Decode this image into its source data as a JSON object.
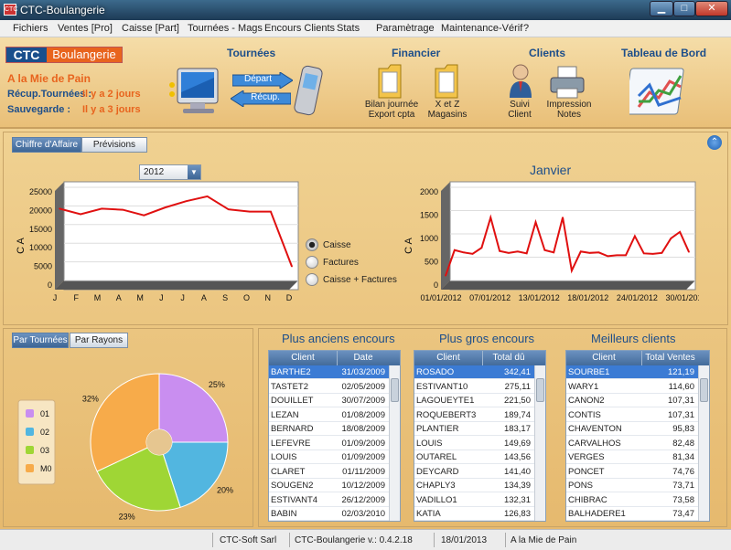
{
  "window": {
    "title": "CTC-Boulangerie",
    "icon_text": "CTC"
  },
  "menu": [
    "Fichiers",
    "Ventes [Pro]",
    "Caisse [Part]",
    "Tournées - Mags",
    "Encours Clients",
    "Stats",
    "Paramètrage",
    "Maintenance-Vérif",
    "?"
  ],
  "brand": {
    "ctc": "CTC",
    "boulangerie": "Boulangerie",
    "shop": "A la Mie de Pain",
    "recup_label": "Récup.Tournées :",
    "recup_value": "Il y a 2 jours",
    "save_label": "Sauvegarde :",
    "save_value": "Il y a 3 jours"
  },
  "sections": {
    "tournees": {
      "title": "Tournées",
      "depart": "Départ",
      "recup": "Récup."
    },
    "financier": {
      "title": "Financier",
      "bilan": "Bilan journée\nExport cpta",
      "xz": "X et Z\nMagasins"
    },
    "clients": {
      "title": "Clients",
      "suivi": "Suivi\nClient",
      "impression": "Impression\nNotes"
    },
    "tableau": {
      "title": "Tableau de Bord"
    }
  },
  "tabs_ca": [
    "Chiffre d'Affaire",
    "Prévisions"
  ],
  "year_select": "2012",
  "radios": {
    "caisse": "Caisse",
    "factures": "Factures",
    "both": "Caisse + Factures",
    "selected": "caisse"
  },
  "tabs_pie": [
    "Par Tournées",
    "Par Rayons"
  ],
  "grids": {
    "anciens": {
      "title": "Plus anciens encours",
      "col1": "Client",
      "col2": "Date",
      "rows": [
        [
          "BARTHE2",
          "31/03/2009"
        ],
        [
          "TASTET2",
          "02/05/2009"
        ],
        [
          "DOUILLET",
          "30/07/2009"
        ],
        [
          "LEZAN",
          "01/08/2009"
        ],
        [
          "BERNARD",
          "18/08/2009"
        ],
        [
          "LEFEVRE",
          "01/09/2009"
        ],
        [
          "LOUIS",
          "01/09/2009"
        ],
        [
          "CLARET",
          "01/11/2009"
        ],
        [
          "SOUGEN2",
          "10/12/2009"
        ],
        [
          "ESTIVANT4",
          "26/12/2009"
        ],
        [
          "BABIN",
          "02/03/2010"
        ]
      ]
    },
    "gros": {
      "title": "Plus gros encours",
      "col1": "Client",
      "col2": "Total dû",
      "rows": [
        [
          "ROSADO",
          "342,41"
        ],
        [
          "ESTIVANT10",
          "275,11"
        ],
        [
          "LAGOUEYTE1",
          "221,50"
        ],
        [
          "ROQUEBERT3",
          "189,74"
        ],
        [
          "PLANTIER",
          "183,17"
        ],
        [
          "LOUIS",
          "149,69"
        ],
        [
          "OUTAREL",
          "143,56"
        ],
        [
          "DEYCARD",
          "141,40"
        ],
        [
          "CHAPLY3",
          "134,39"
        ],
        [
          "VADILLO1",
          "132,31"
        ],
        [
          "KATIA",
          "126,83"
        ]
      ]
    },
    "meilleurs": {
      "title": "Meilleurs clients",
      "col1": "Client",
      "col2": "Total Ventes",
      "rows": [
        [
          "SOURBE1",
          "121,19"
        ],
        [
          "WARY1",
          "114,60"
        ],
        [
          "CANON2",
          "107,31"
        ],
        [
          "CONTIS",
          "107,31"
        ],
        [
          "CHAVENTON",
          "95,83"
        ],
        [
          "CARVALHOS",
          "82,48"
        ],
        [
          "VERGES",
          "81,34"
        ],
        [
          "PONCET",
          "74,76"
        ],
        [
          "PONS",
          "73,71"
        ],
        [
          "CHIBRAC",
          "73,58"
        ],
        [
          "BALHADERE1",
          "73,47"
        ]
      ]
    }
  },
  "status": {
    "company": "CTC-Soft Sarl",
    "version": "CTC-Boulangerie v.: 0.4.2.18",
    "date": "18/01/2013",
    "shop": "A la Mie de Pain"
  },
  "chart_data": [
    {
      "type": "line",
      "title": "",
      "ylabel": "C A",
      "categories": [
        "J",
        "F",
        "M",
        "A",
        "M",
        "J",
        "J",
        "A",
        "S",
        "O",
        "N",
        "D"
      ],
      "yticks": [
        "0",
        "5000",
        "10000",
        "15000",
        "20000",
        "25000"
      ],
      "ylim": [
        0,
        25000
      ],
      "values": [
        20500,
        19000,
        20500,
        20200,
        18700,
        20800,
        22500,
        23800,
        20300,
        19700,
        19700,
        5000
      ],
      "color": "#e01010"
    },
    {
      "type": "line",
      "title": "Janvier",
      "ylabel": "C A",
      "categories": [
        "01/01/2012",
        "07/01/2012",
        "13/01/2012",
        "18/01/2012",
        "24/01/2012",
        "30/01/2012"
      ],
      "yticks": [
        "0",
        "500",
        "1000",
        "1500",
        "2000"
      ],
      "ylim": [
        0,
        2000
      ],
      "values": [
        200,
        750,
        700,
        670,
        800,
        1450,
        730,
        690,
        720,
        680,
        1350,
        750,
        700,
        1450,
        310,
        720,
        690,
        700,
        620,
        640,
        640,
        1050,
        680,
        670,
        690,
        1000,
        1140,
        710
      ],
      "color": "#e01010"
    },
    {
      "type": "pie",
      "legend": [
        "01",
        "02",
        "03",
        "M0"
      ],
      "values": [
        25,
        20,
        23,
        32
      ],
      "labels": [
        "25%",
        "20%",
        "23%",
        "32%"
      ],
      "colors": [
        "#c98ef0",
        "#52b6e0",
        "#9fd635",
        "#f7ab4a"
      ]
    }
  ]
}
